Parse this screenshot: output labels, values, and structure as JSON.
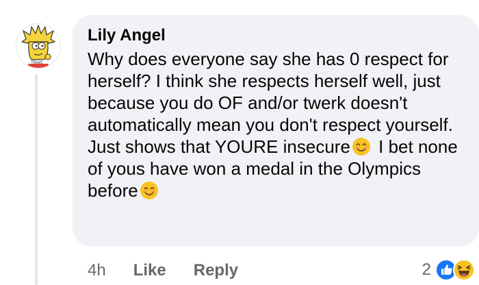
{
  "comment": {
    "author": "Lily Angel",
    "text_part1": "Why does everyone say she has 0 respect for herself? I think she respects herself well, just because you do OF and/or twerk doesn't automatically mean you don't respect yourself. Just shows that YOURE insecure",
    "text_part2": "I bet none of yous have won a medal in the Olympics before",
    "emoji_1": "smiling-face-with-smiling-eyes",
    "emoji_2": "smiling-face-with-smiling-eyes"
  },
  "actions": {
    "time": "4h",
    "like_label": "Like",
    "reply_label": "Reply"
  },
  "reactions": {
    "count": "2",
    "types": [
      "like-icon",
      "haha-icon"
    ]
  },
  "colors": {
    "bubble": "#f0f2f5",
    "text": "#050505",
    "secondary": "#65676b",
    "like_blue": "#1877f2",
    "haha_yellow": "#f7c324"
  }
}
